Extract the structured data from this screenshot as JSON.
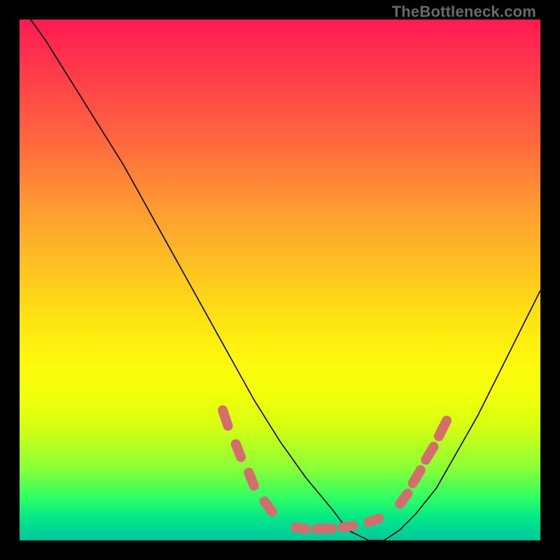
{
  "attribution": "TheBottleneck.com",
  "chart_data": {
    "type": "line",
    "title": "",
    "xlabel": "",
    "ylabel": "",
    "xlim": [
      0,
      100
    ],
    "ylim": [
      0,
      100
    ],
    "curve": {
      "x": [
        0,
        5,
        10,
        15,
        20,
        25,
        30,
        35,
        40,
        45,
        50,
        55,
        60,
        63,
        67,
        70,
        73,
        76,
        80,
        84,
        88,
        92,
        96,
        100
      ],
      "y": [
        103,
        96,
        88,
        80,
        72,
        63,
        54,
        45,
        36,
        27,
        19,
        12,
        6,
        2,
        0,
        0,
        2,
        5,
        10,
        17,
        24,
        32,
        40,
        48
      ]
    },
    "markers": {
      "note": "highlighted salmon segments near curve minimum",
      "segments": [
        {
          "x0": 39,
          "y0": 25,
          "x1": 40,
          "y1": 22
        },
        {
          "x0": 41.5,
          "y0": 18.5,
          "x1": 42.5,
          "y1": 16
        },
        {
          "x0": 44,
          "y0": 13,
          "x1": 45,
          "y1": 10.5
        },
        {
          "x0": 47,
          "y0": 7.5,
          "x1": 48.5,
          "y1": 5.5
        },
        {
          "x0": 53,
          "y0": 2.5,
          "x1": 55,
          "y1": 2.2
        },
        {
          "x0": 57,
          "y0": 2.2,
          "x1": 60,
          "y1": 2.3
        },
        {
          "x0": 62,
          "y0": 2.5,
          "x1": 64,
          "y1": 2.8
        },
        {
          "x0": 67,
          "y0": 3.5,
          "x1": 69,
          "y1": 4.2
        },
        {
          "x0": 73,
          "y0": 7,
          "x1": 74.5,
          "y1": 9
        },
        {
          "x0": 75.5,
          "y0": 11,
          "x1": 77,
          "y1": 13.5
        },
        {
          "x0": 78,
          "y0": 15.5,
          "x1": 79.5,
          "y1": 18
        },
        {
          "x0": 80.5,
          "y0": 20,
          "x1": 82,
          "y1": 23
        }
      ]
    }
  }
}
